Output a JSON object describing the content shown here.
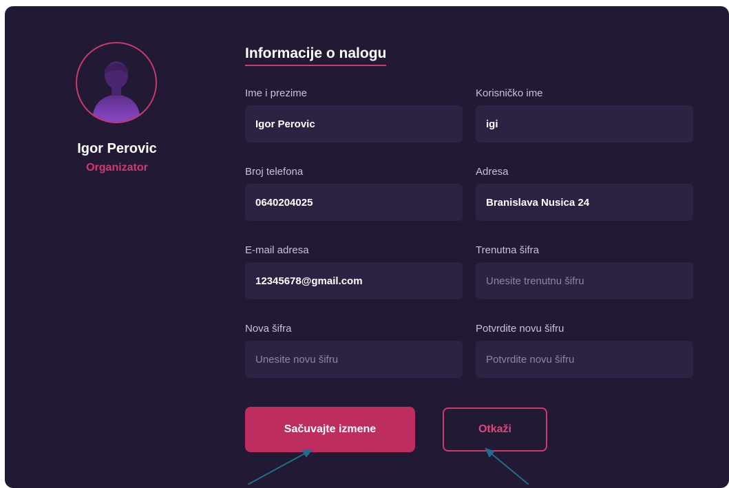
{
  "profile": {
    "name": "Igor Perovic",
    "role": "Organizator",
    "avatar_icon": "user-avatar-icon"
  },
  "form": {
    "title": "Informacije o nalogu",
    "full_name": {
      "label": "Ime i prezime",
      "value": "Igor Perovic"
    },
    "username": {
      "label": "Korisničko ime",
      "value": "igi"
    },
    "phone": {
      "label": "Broj telefona",
      "value": "0640204025"
    },
    "address": {
      "label": "Adresa",
      "value": "Branislava Nusica 24"
    },
    "email": {
      "label": "E-mail adresa",
      "value": "12345678@gmail.com"
    },
    "current_password": {
      "label": "Trenutna šifra",
      "value": "",
      "placeholder": "Unesite trenutnu šifru"
    },
    "new_password": {
      "label": "Nova šifra",
      "value": "",
      "placeholder": "Unesite novu šifru"
    },
    "confirm_password": {
      "label": "Potvrdite novu šifru",
      "value": "",
      "placeholder": "Potvrdite novu šifru"
    }
  },
  "actions": {
    "save_label": "Sačuvajte izmene",
    "cancel_label": "Otkaži"
  },
  "colors": {
    "card_bg": "#221a35",
    "field_bg": "#2d2243",
    "accent": "#d03a6f",
    "save_bg": "#bd2d5f",
    "annotation_arrow": "#1f6e8c"
  }
}
